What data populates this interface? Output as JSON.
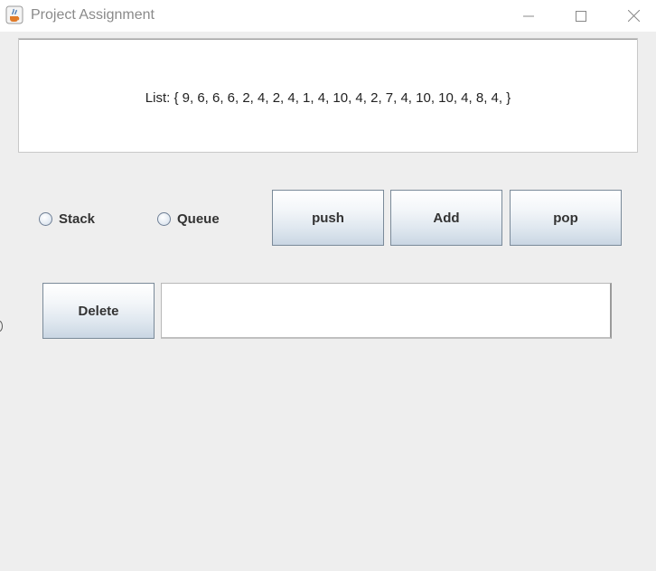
{
  "window": {
    "title": "Project Assignment",
    "icon": "java-cup-icon",
    "controls": [
      "minimize-icon",
      "maximize-icon",
      "close-icon"
    ]
  },
  "list_panel": {
    "text": "List: { 9, 6, 6, 6, 2, 4, 2, 4, 1, 4, 10, 4, 2, 7, 4, 10, 10, 4, 8, 4, }"
  },
  "mode": {
    "options": [
      {
        "label": "Stack",
        "selected": false
      },
      {
        "label": "Queue",
        "selected": false
      }
    ]
  },
  "buttons": {
    "push": "push",
    "add": "Add",
    "pop": "pop",
    "delete": "Delete"
  },
  "input": {
    "value": "",
    "placeholder": ""
  },
  "colors": {
    "background": "#eeeeee",
    "button_border": "#7a8a99",
    "button_gradient_bottom": "#c9d6e3"
  }
}
